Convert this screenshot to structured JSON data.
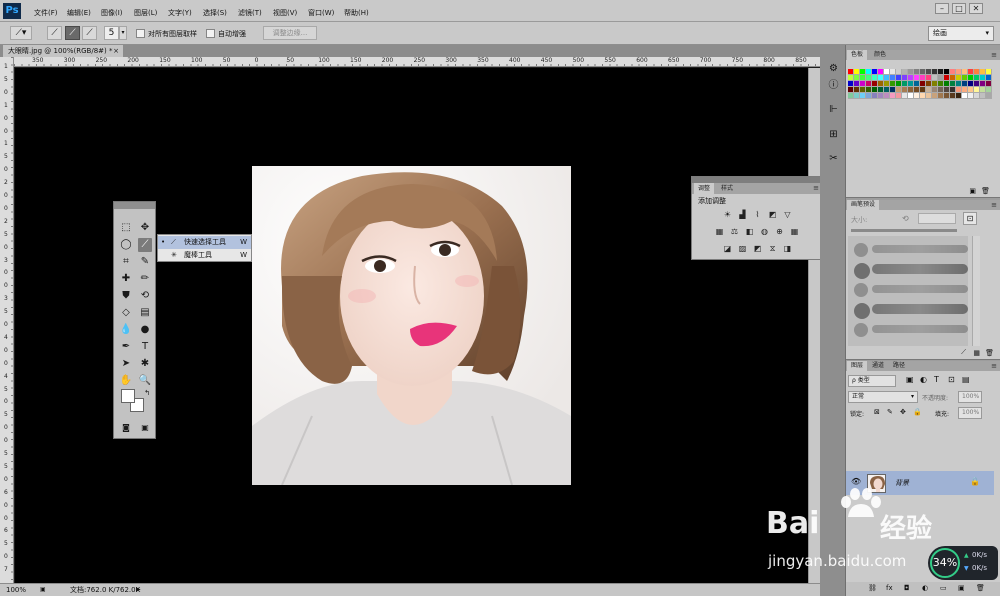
{
  "app": {
    "logo": "Ps",
    "menu": [
      "文件(F)",
      "编辑(E)",
      "图像(I)",
      "图层(L)",
      "文字(Y)",
      "选择(S)",
      "滤镜(T)",
      "视图(V)",
      "窗口(W)",
      "帮助(H)"
    ]
  },
  "options": {
    "brush_size": "5",
    "sample_all_layers": "对所有图层取样",
    "auto_enhance": "自动增强",
    "refine_edge": "调整边缘...",
    "workspace": "绘画"
  },
  "document": {
    "tab_title": "大眼睛.jpg @ 100%(RGB/8#) *",
    "zoom": "100%",
    "doc_size": "文档:762.0 K/762.0K"
  },
  "rulers": {
    "top": [
      "350",
      "300",
      "250",
      "200",
      "150",
      "100",
      "50",
      "0",
      "50",
      "100",
      "150",
      "200",
      "250",
      "300",
      "350",
      "400",
      "450",
      "500",
      "550",
      "600",
      "650",
      "700",
      "750",
      "800",
      "850"
    ],
    "left": [
      "1",
      "5",
      "0",
      "1",
      "0",
      "0",
      "1",
      "5",
      "0",
      "2",
      "0",
      "0",
      "2",
      "5",
      "0",
      "3",
      "0",
      "0",
      "3",
      "5",
      "0",
      "4",
      "0",
      "0",
      "4",
      "5",
      "0",
      "5",
      "0",
      "0",
      "5",
      "5",
      "0",
      "6",
      "0",
      "0",
      "6",
      "5",
      "0",
      "7"
    ]
  },
  "flyout": {
    "items": [
      {
        "name": "快速选择工具",
        "key": "W"
      },
      {
        "name": "魔棒工具",
        "key": "W"
      }
    ]
  },
  "adjustments": {
    "tabs": [
      "调整",
      "样式"
    ],
    "title": "添加调整"
  },
  "swatches": {
    "tabs": [
      "色板",
      "颜色"
    ],
    "colors": [
      "#ff0000",
      "#ffff00",
      "#00ff00",
      "#00ffff",
      "#0000ff",
      "#ff00ff",
      "#ffffff",
      "#e6e6e6",
      "#cccccc",
      "#b3b3b3",
      "#999999",
      "#808080",
      "#666666",
      "#4d4d4d",
      "#333333",
      "#1a1a1a",
      "#000000",
      "#ff7f7f",
      "#ff9f7f",
      "#ffbf7f",
      "#ff3f3f",
      "#ff7f3f",
      "#ffbf3f",
      "#ffff3f",
      "#bfff3f",
      "#7fff3f",
      "#3fff3f",
      "#3fff7f",
      "#3fffbf",
      "#3fffff",
      "#3fbfff",
      "#3f7fff",
      "#3f3fff",
      "#7f3fff",
      "#bf3fff",
      "#ff3fff",
      "#ff3fbf",
      "#ff3f7f",
      "#c0c0c0",
      "#a0a0a0",
      "#cc0000",
      "#cc6600",
      "#cccc00",
      "#66cc00",
      "#00cc00",
      "#00cc66",
      "#00cccc",
      "#0066cc",
      "#0000cc",
      "#6600cc",
      "#cc00cc",
      "#cc0066",
      "#990000",
      "#996600",
      "#999900",
      "#339900",
      "#009900",
      "#009966",
      "#009999",
      "#006699",
      "#800000",
      "#804000",
      "#808000",
      "#408000",
      "#008000",
      "#008040",
      "#008080",
      "#004080",
      "#000080",
      "#400080",
      "#800080",
      "#800040",
      "#600000",
      "#603000",
      "#606000",
      "#306000",
      "#006000",
      "#006030",
      "#006060",
      "#003060",
      "#c69c6d",
      "#a67c52",
      "#8c6239",
      "#754c24",
      "#603913",
      "#c7b299",
      "#998675",
      "#736357",
      "#534741",
      "#362f2d",
      "#f7977a",
      "#fbad82",
      "#fdc68c",
      "#fff799",
      "#c4df9b",
      "#a3d39c",
      "#82ca9c",
      "#7bcdc8",
      "#6ecff6",
      "#7ea7d8"
    ],
    "extra": [
      "#8781bd",
      "#a187be",
      "#bc8dbf",
      "#f49bc1",
      "#f5989d",
      "#e6e6e6",
      "#ffffff",
      "#fff0e0",
      "#ffd8b0",
      "#eac49c",
      "#c8a27c",
      "#a07850",
      "#7a5634",
      "#5a3a1e",
      "#3a2410",
      "#ffffff",
      "#f0f0f0",
      "#d8d8d8",
      "#c0c0c0",
      "#a8a8a8"
    ]
  },
  "brushes": {
    "tab": "画笔预设",
    "size_label": "大小:"
  },
  "layers": {
    "tabs": [
      "图层",
      "通道",
      "路径"
    ],
    "filter": "ρ 类型",
    "blend_mode": "正常",
    "opacity_label": "不透明度:",
    "opacity_value": "100%",
    "lock_label": "锁定:",
    "fill_label": "填充:",
    "fill_value": "100%",
    "layer_name": "背景"
  },
  "watermark": {
    "brand": "Bai",
    "brand2": "经验",
    "url": "jingyan.baidu.com"
  },
  "network": {
    "percent": "34%",
    "up": "0K/s",
    "down": "0K/s"
  }
}
